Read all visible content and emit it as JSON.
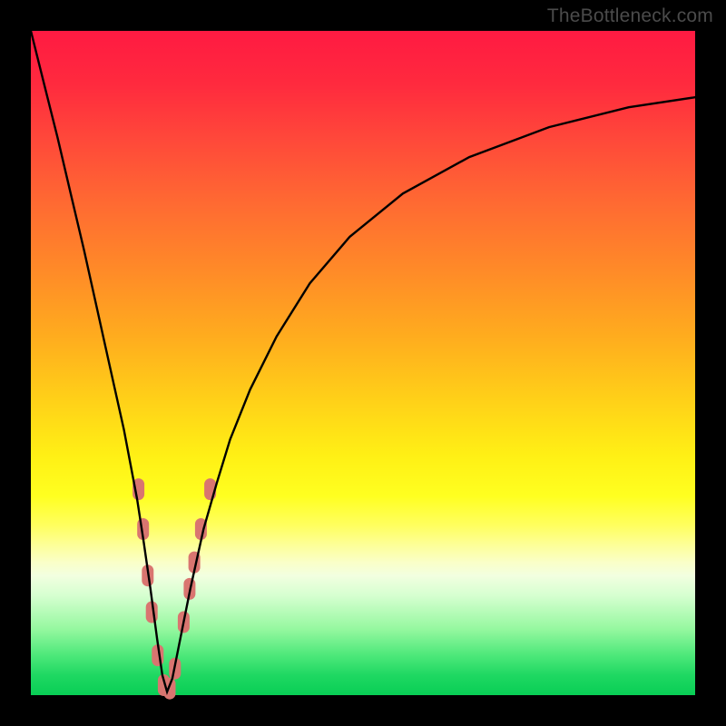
{
  "watermark": "TheBottleneck.com",
  "chart_data": {
    "type": "line",
    "title": "",
    "xlabel": "",
    "ylabel": "",
    "xlim": [
      0,
      100
    ],
    "ylim": [
      0,
      100
    ],
    "series": [
      {
        "name": "bottleneck-curve",
        "x": [
          0,
          2,
          4,
          6,
          8,
          10,
          12,
          14,
          16,
          17,
          18,
          19,
          19.8,
          20.5,
          21.3,
          22.6,
          24,
          26,
          28,
          30,
          33,
          37,
          42,
          48,
          56,
          66,
          78,
          90,
          100
        ],
        "values": [
          100,
          92,
          84,
          75.5,
          67,
          58,
          49,
          40,
          29.5,
          23,
          16,
          8.5,
          3,
          0.5,
          2.5,
          9,
          16,
          25,
          32,
          38.5,
          46,
          54,
          62,
          69,
          75.5,
          81,
          85.5,
          88.5,
          90
        ]
      }
    ],
    "markers": {
      "name": "highlight-beads",
      "color": "#d97570",
      "points": [
        {
          "x": 16.2,
          "y": 31
        },
        {
          "x": 16.9,
          "y": 25
        },
        {
          "x": 17.6,
          "y": 18
        },
        {
          "x": 18.2,
          "y": 12.5
        },
        {
          "x": 19.1,
          "y": 6
        },
        {
          "x": 20.0,
          "y": 1.5
        },
        {
          "x": 20.9,
          "y": 1
        },
        {
          "x": 21.7,
          "y": 4
        },
        {
          "x": 23.0,
          "y": 11
        },
        {
          "x": 23.9,
          "y": 16
        },
        {
          "x": 24.6,
          "y": 20
        },
        {
          "x": 25.6,
          "y": 25
        },
        {
          "x": 27.0,
          "y": 31
        }
      ]
    }
  },
  "colors": {
    "curve": "#000000",
    "bead": "#d97570",
    "bg_top": "#ff1a42",
    "bg_bottom": "#09ce55"
  }
}
